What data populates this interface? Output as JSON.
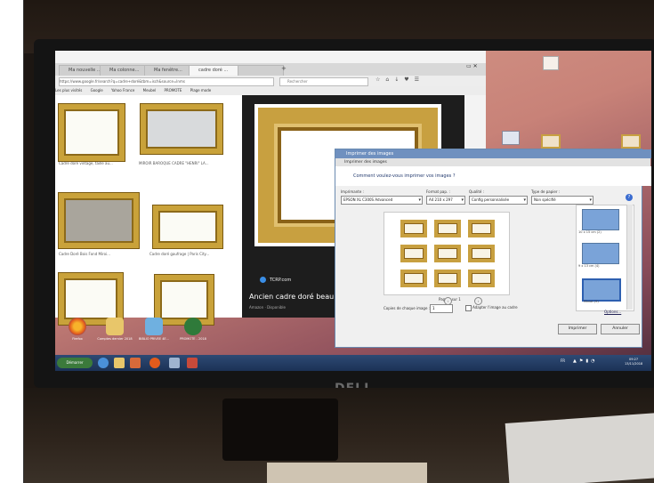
{
  "monitor": {
    "brand": "DELL"
  },
  "browser": {
    "tabs": [
      {
        "label": "Ma nouvelle ..."
      },
      {
        "label": "Ma colonne..."
      },
      {
        "label": "Ma fenêtre..."
      },
      {
        "label": "cadre doré ..."
      },
      {
        "label": ""
      }
    ],
    "url": "https://www.google.fr/search?q=cadre+doré&tbm=isch&source=lnms",
    "search_placeholder": "Rechercher",
    "bookmarks": [
      "Les plus visités",
      "Google",
      "Yahoo France",
      "Meubel",
      "PROMOTE",
      "Plage mode"
    ],
    "results": [
      {
        "caption": "Cadre doré vintage, taille au..."
      },
      {
        "caption": "MIROIR BAROQUE CADRE \"HENRI\" LA..."
      },
      {
        "caption": "Cadre Doré Bois Fond Miroi..."
      },
      {
        "caption": "Cadre doré gaufrage | Paris City..."
      }
    ],
    "preview": {
      "source": "TCRP.com",
      "title": "Ancien cadre doré beau t",
      "subtitle": "Amazon · Disponible"
    }
  },
  "print_dialog": {
    "window_title": "Imprimer des images",
    "header": "Imprimer des images",
    "question": "Comment voulez-vous imprimer vos images ?",
    "fields": {
      "printer": {
        "label": "Imprimante :",
        "value": "EPSON XL C300S Advanced"
      },
      "paper_size": {
        "label": "Format pap. :",
        "value": "A4 210 x 297"
      },
      "quality": {
        "label": "Qualité :",
        "value": "Config personnalisée"
      },
      "paper_type": {
        "label": "Type de papier :",
        "value": "Non spécifié"
      }
    },
    "page_label": "Page 1 sur 1",
    "copies_label": "Copies de chaque image :",
    "copies_value": "1",
    "fit_label": "Adapter l'image au cadre",
    "options_link": "Options...",
    "layouts": [
      {
        "label": "10 x 15 cm (2)"
      },
      {
        "label": "9 x 13 cm (4)"
      },
      {
        "label": "Miniat (9)"
      }
    ],
    "print_button": "Imprimer",
    "cancel_button": "Annuler"
  },
  "desktop_icons": [
    {
      "label": "Firefox"
    },
    {
      "label": "Comptes dernier 2018"
    },
    {
      "label": "BIBLIO PRIVEE 4E..."
    },
    {
      "label": "PROMOTE - 2018"
    }
  ],
  "taskbar": {
    "start_label": "Démarrer",
    "tray_lang": "FR",
    "clock_time": "09:27",
    "clock_date": "13/11/2018"
  }
}
